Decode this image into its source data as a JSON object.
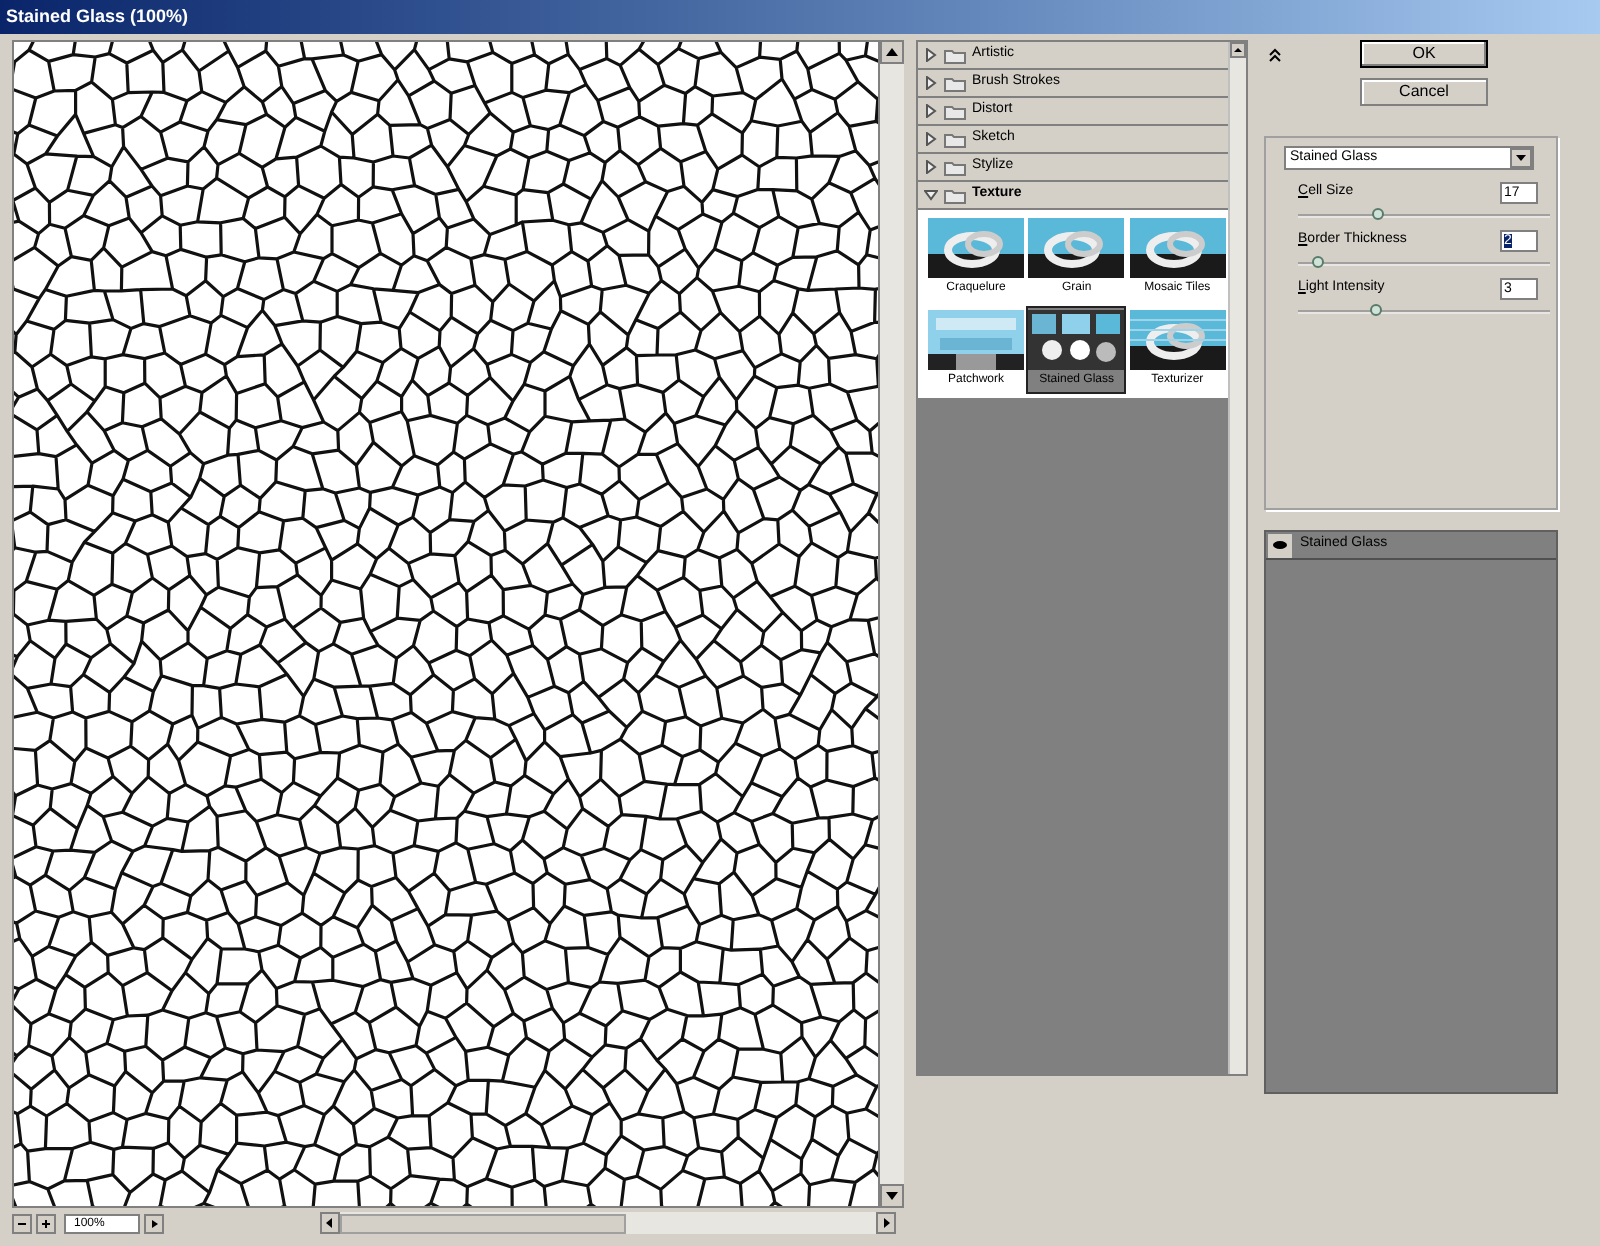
{
  "window": {
    "title": "Stained Glass (100%)"
  },
  "preview": {
    "zoom": "100%"
  },
  "categories": [
    {
      "label": "Artistic",
      "expanded": false
    },
    {
      "label": "Brush Strokes",
      "expanded": false
    },
    {
      "label": "Distort",
      "expanded": false
    },
    {
      "label": "Sketch",
      "expanded": false
    },
    {
      "label": "Stylize",
      "expanded": false
    },
    {
      "label": "Texture",
      "expanded": true,
      "filters": [
        {
          "label": "Craquelure",
          "selected": false
        },
        {
          "label": "Grain",
          "selected": false
        },
        {
          "label": "Mosaic Tiles",
          "selected": false
        },
        {
          "label": "Patchwork",
          "selected": false
        },
        {
          "label": "Stained Glass",
          "selected": true
        },
        {
          "label": "Texturizer",
          "selected": false
        }
      ]
    }
  ],
  "buttons": [
    "OK",
    "Cancel"
  ],
  "settings": {
    "filter": "Stained Glass",
    "params": [
      {
        "label": "Cell Size",
        "value": "17",
        "level": 0.31,
        "selected": false
      },
      {
        "label": "Border Thickness",
        "value": "2",
        "level": 0.06,
        "selected": true
      },
      {
        "label": "Light Intensity",
        "value": "3",
        "level": 0.3,
        "selected": false
      }
    ]
  },
  "layers": [
    {
      "label": "Stained Glass",
      "visible": true
    }
  ]
}
